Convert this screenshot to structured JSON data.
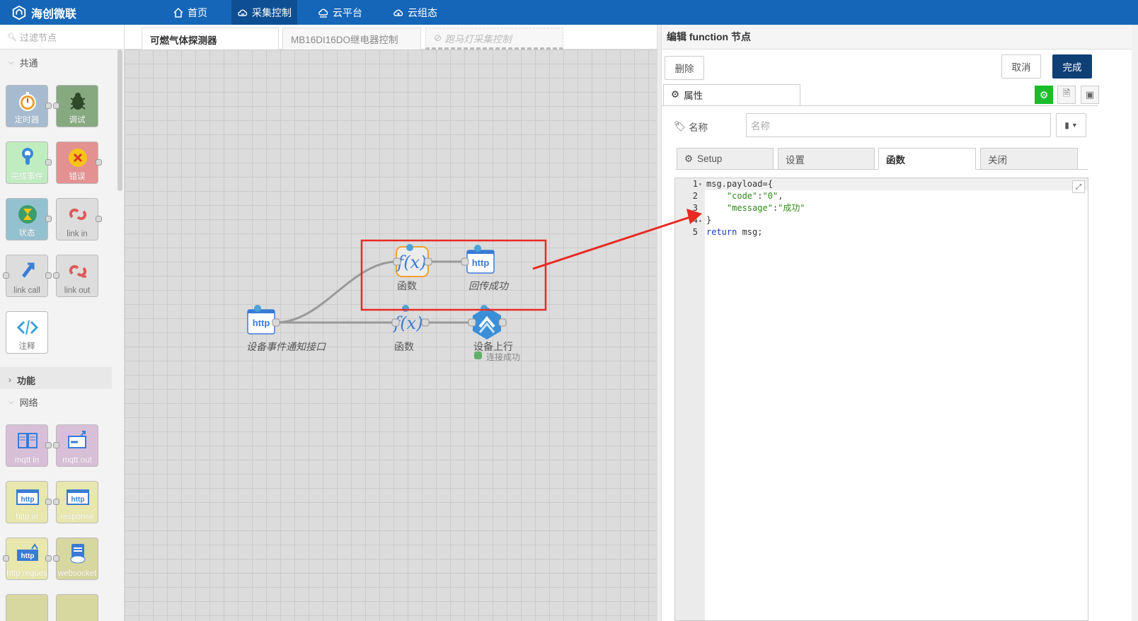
{
  "topbar": {
    "brand": "海创微联",
    "nav": [
      {
        "label": "首页",
        "icon": "home-icon"
      },
      {
        "label": "采集控制",
        "icon": "cloud-sync-icon"
      },
      {
        "label": "云平台",
        "icon": "cloud-platform-icon"
      },
      {
        "label": "云组态",
        "icon": "cloud-config-icon"
      }
    ],
    "active_index": 1
  },
  "palette": {
    "filter_placeholder": "过滤节点",
    "categories": {
      "common": "共通",
      "function": "功能",
      "network": "网络"
    },
    "nodes": {
      "inject": "定时器",
      "debug": "调试",
      "complete": "完成事件",
      "catch": "错误",
      "status": "状态",
      "link_in": "link in",
      "link_call": "link call",
      "link_out": "link out",
      "comment": "注释",
      "mqtt_in": "mqtt in",
      "mqtt_out": "mqtt out",
      "http_in": "http in",
      "http_response": "response",
      "http_request": "http reques",
      "websocket": "websocket"
    }
  },
  "workspace": {
    "tabs": [
      {
        "label": "可燃气体探测器",
        "state": "active"
      },
      {
        "label": "MB16DI16DO继电器控制",
        "state": "normal"
      },
      {
        "label": "跑马灯采集控制",
        "state": "disabled"
      }
    ],
    "flow_nodes": {
      "http_in_label": "设备事件通知接口",
      "function1_label": "函数",
      "function2_label": "函数",
      "http_response_label": "回传成功",
      "device_up_label": "设备上行",
      "device_up_status": "连接成功",
      "http_badge": "http",
      "fx_badge": "f(x)"
    },
    "colors": {
      "highlight_box": "#e82a22",
      "arrow": "#e82a22",
      "status_dot": "#62b06a"
    }
  },
  "tray": {
    "title": "编辑 function 节点",
    "delete_label": "删除",
    "cancel_label": "取消",
    "done_label": "完成",
    "properties_tab": "属性",
    "name_label": "名称",
    "name_placeholder": "名称",
    "sub_tabs": [
      {
        "label": "Setup",
        "icon": "gear-icon"
      },
      {
        "label": "设置",
        "icon": ""
      },
      {
        "label": "函数",
        "icon": ""
      },
      {
        "label": "关闭",
        "icon": ""
      }
    ],
    "active_sub_tab": 2,
    "code": {
      "line_numbers": [
        "1",
        "2",
        "3",
        "4",
        "5"
      ],
      "lines": [
        [
          {
            "t": "msg.payload={",
            "c": "op"
          }
        ],
        [
          {
            "t": "    ",
            "c": "op"
          },
          {
            "t": "\"code\"",
            "c": "str"
          },
          {
            "t": ":",
            "c": "op"
          },
          {
            "t": "\"0\"",
            "c": "str"
          },
          {
            "t": ",",
            "c": "op"
          }
        ],
        [
          {
            "t": "    ",
            "c": "op"
          },
          {
            "t": "\"message\"",
            "c": "str"
          },
          {
            "t": ":",
            "c": "op"
          },
          {
            "t": "\"成功\"",
            "c": "str"
          }
        ],
        [
          {
            "t": "}",
            "c": "op"
          }
        ],
        [
          {
            "t": "return",
            "c": "kw"
          },
          {
            "t": " msg;",
            "c": "op"
          }
        ]
      ]
    },
    "accent_primary": "#0e3f75",
    "accent_green": "#1abc2c"
  }
}
